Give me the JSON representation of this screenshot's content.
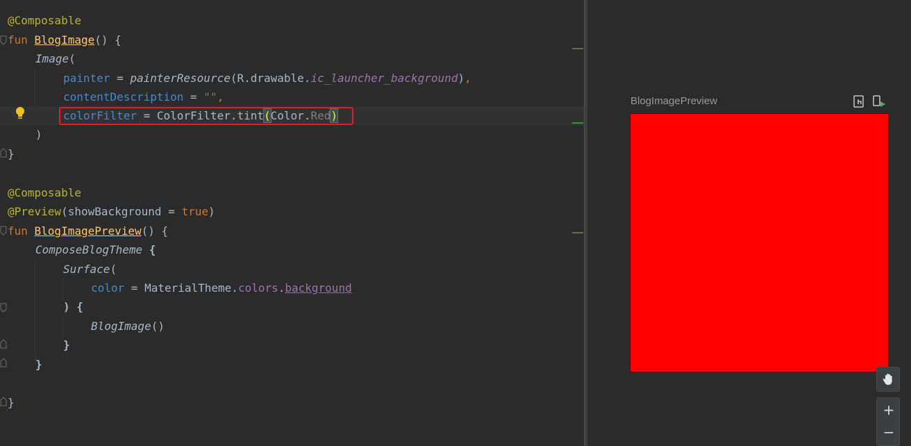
{
  "editor": {
    "lines": {
      "l1": {
        "ann": "@Composable"
      },
      "l2": {
        "kw": "fun ",
        "name": "BlogImage",
        "rest": "() {"
      },
      "l3": {
        "call": "Image",
        "rest": "("
      },
      "l4": {
        "param": "painter",
        "eq": " = ",
        "call": "painterResource",
        "open": "(R.drawable.",
        "field": "ic_launcher_background",
        "close": ")",
        "comma": ","
      },
      "l5": {
        "param": "contentDescription",
        "eq": " = ",
        "str": "\"\"",
        "comma": ","
      },
      "l6": {
        "param": "colorFilter",
        "eq": " = ",
        "obj": "ColorFilter.tint",
        "open": "(",
        "arg1": "Color.",
        "arg2": "Red",
        "close": ")"
      },
      "l7": {
        "text": ")"
      },
      "l8": {
        "text": "}"
      },
      "l9": {
        "ann": "@Composable"
      },
      "l10": {
        "ann": "@Preview",
        "open": "(showBackground = ",
        "kw": "true",
        "close": ")"
      },
      "l11": {
        "kw": "fun ",
        "name": "BlogImagePreview",
        "rest": "() {"
      },
      "l12": {
        "call": "ComposeBlogTheme",
        "rest": " {"
      },
      "l13": {
        "call": "Surface",
        "rest": "("
      },
      "l14": {
        "param": "color",
        "eq": " = ",
        "obj": "MaterialTheme.",
        "field": "colors",
        "dot": ".",
        "field2": "background"
      },
      "l15": {
        "text": ") {"
      },
      "l16": {
        "call": "BlogImage",
        "rest": "()"
      },
      "l17": {
        "text": "}"
      },
      "l18": {
        "text": "}"
      },
      "l19": {
        "text": "}"
      }
    },
    "icons": {
      "bulb": "lightbulb-icon"
    }
  },
  "preview": {
    "title": "BlogImagePreview",
    "fill_color": "#ff0000",
    "controls": {
      "pan": "hand-icon",
      "zoom_in": "+",
      "zoom_out": "−"
    }
  }
}
